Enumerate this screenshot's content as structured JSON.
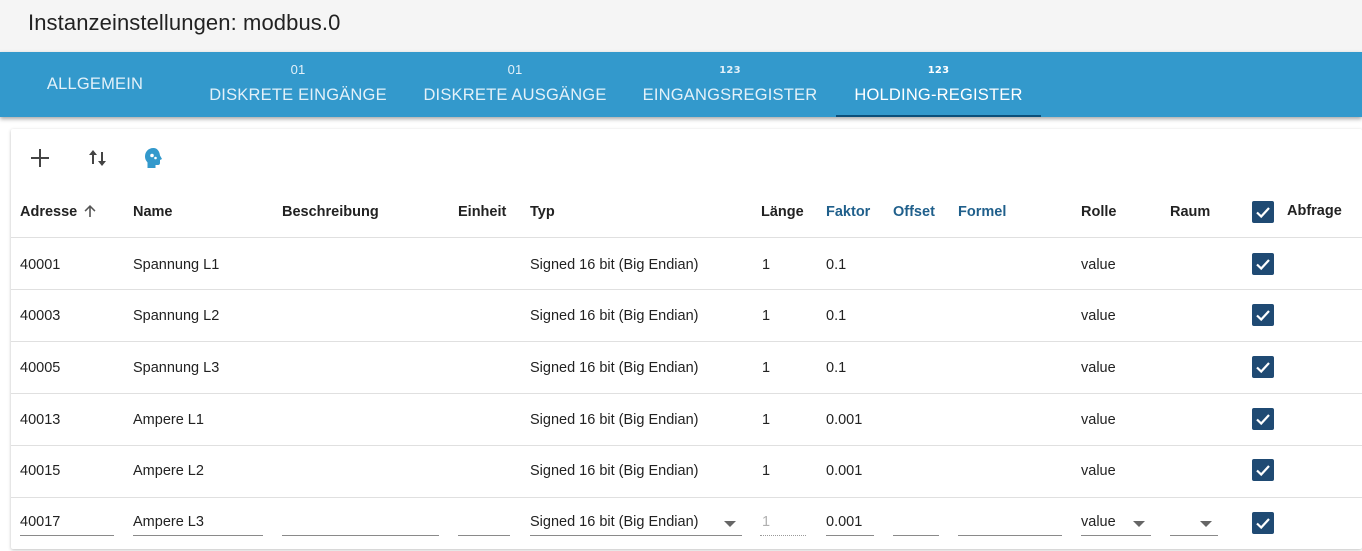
{
  "window": {
    "title": "Instanzeinstellungen: modbus.0"
  },
  "tabs": [
    {
      "label": "ALLGEMEIN",
      "icon": ""
    },
    {
      "label": "DISKRETE EINGÄNGE",
      "icon": "01"
    },
    {
      "label": "DISKRETE AUSGÄNGE",
      "icon": "01"
    },
    {
      "label": "EINGANGSREGISTER",
      "icon": "123"
    },
    {
      "label": "HOLDING-REGISTER",
      "icon": "123"
    }
  ],
  "active_tab": "HOLDING-REGISTER",
  "toolbar": {
    "add_icon": "plus-icon",
    "import_export_icon": "swap-vertical-icon",
    "agent_icon": "head-profile-icon",
    "accent": "#3399cc"
  },
  "table": {
    "headers": {
      "address": "Adresse",
      "name": "Name",
      "description": "Beschreibung",
      "unit": "Einheit",
      "type": "Typ",
      "length": "Länge",
      "factor": "Faktor",
      "offset": "Offset",
      "formula": "Formel",
      "role": "Rolle",
      "room": "Raum",
      "poll": "Abfrage"
    },
    "sorted_by": "address",
    "sort_direction": "ascending",
    "poll_all_checked": true,
    "rows": [
      {
        "address": "40001",
        "name": "Spannung L1",
        "description": "",
        "unit": "",
        "type": "Signed 16 bit (Big Endian)",
        "length": "1",
        "factor": "0.1",
        "offset": "",
        "formula": "",
        "role": "value",
        "room": "",
        "poll": true
      },
      {
        "address": "40003",
        "name": "Spannung L2",
        "description": "",
        "unit": "",
        "type": "Signed 16 bit (Big Endian)",
        "length": "1",
        "factor": "0.1",
        "offset": "",
        "formula": "",
        "role": "value",
        "room": "",
        "poll": true
      },
      {
        "address": "40005",
        "name": "Spannung L3",
        "description": "",
        "unit": "",
        "type": "Signed 16 bit (Big Endian)",
        "length": "1",
        "factor": "0.1",
        "offset": "",
        "formula": "",
        "role": "value",
        "room": "",
        "poll": true
      },
      {
        "address": "40013",
        "name": "Ampere L1",
        "description": "",
        "unit": "",
        "type": "Signed 16 bit (Big Endian)",
        "length": "1",
        "factor": "0.001",
        "offset": "",
        "formula": "",
        "role": "value",
        "room": "",
        "poll": true
      },
      {
        "address": "40015",
        "name": "Ampere L2",
        "description": "",
        "unit": "",
        "type": "Signed 16 bit (Big Endian)",
        "length": "1",
        "factor": "0.001",
        "offset": "",
        "formula": "",
        "role": "value",
        "room": "",
        "poll": true
      }
    ],
    "edit_row": {
      "address": "40017",
      "name": "Ampere L3",
      "description": "",
      "unit": "",
      "type": "Signed 16 bit (Big Endian)",
      "length": "1",
      "factor": "0.001",
      "offset": "",
      "formula": "",
      "role": "value",
      "room": "",
      "poll": true
    }
  }
}
